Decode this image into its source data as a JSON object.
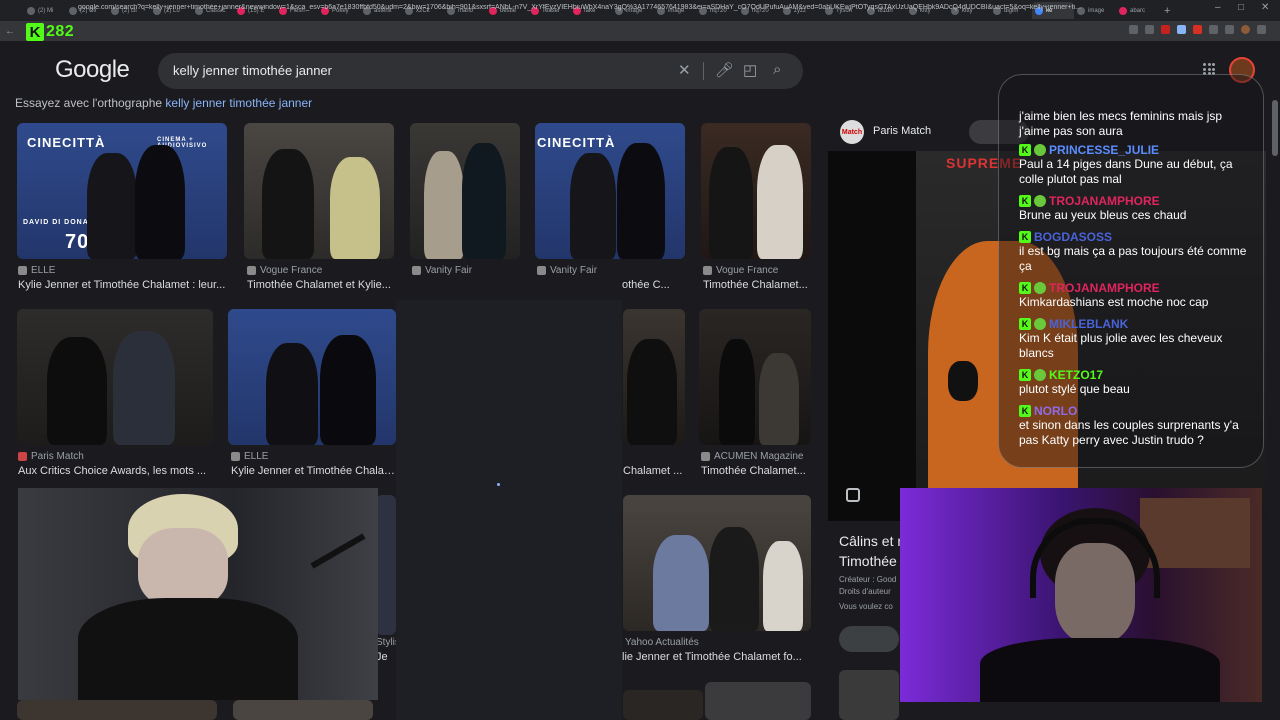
{
  "tabs": [
    {
      "label": "(2) Mi"
    },
    {
      "label": "(2) Cli"
    },
    {
      "label": "(2) cli"
    },
    {
      "label": "(2) Lo"
    },
    {
      "label": "Classic"
    },
    {
      "label": "(15) E"
    },
    {
      "label": "Flesh"
    },
    {
      "label": "Pokey"
    },
    {
      "label": "asterix"
    },
    {
      "label": "x2Ck"
    },
    {
      "label": "mario"
    },
    {
      "label": "bestle"
    },
    {
      "label": "Teaser"
    },
    {
      "label": "fake"
    },
    {
      "label": "image"
    },
    {
      "label": "image"
    },
    {
      "label": "hq720"
    },
    {
      "label": "hq720"
    },
    {
      "label": "zyzz"
    },
    {
      "label": "Tyson"
    },
    {
      "label": "i81dh"
    },
    {
      "label": "kitty"
    },
    {
      "label": "kitty"
    },
    {
      "label": "digim"
    },
    {
      "label": "ke",
      "active": true
    },
    {
      "label": "image"
    },
    {
      "label": "abarc"
    }
  ],
  "address_bar": {
    "url": "google.com/search?q=kelly+jenner+timothée+janner&newwindow=1&sca_esv=b6a7e1830ffbfd50&udm=2&biw=1706&bih=901&sxsrf=ANbL-n7V_XrYfEyzVIEHbiuWbX4naY3gQ%3A1774657641983&ei=aSDHaY_cO7OdUPufuAuAM&ved=0ahUKEwjPtOTyqsGTAxUzUaQEHbk9ADcQ4dUDCBI&uact=5&oq=kelly+jenner+ti..."
  },
  "stream": {
    "viewer_count": "282"
  },
  "google": {
    "logo": "Google",
    "query": "kelly jenner timothée janner",
    "spelling_prefix": "Essayez avec l'orthographe",
    "spelling_suggestion": "kelly jenner timothée janner"
  },
  "results": [
    {
      "source": "ELLE",
      "title": "Kylie Jenner et Timothée Chalamet : leur..."
    },
    {
      "source": "Vogue France",
      "title": "Timothée Chalamet et Kylie..."
    },
    {
      "source": "Vanity Fair",
      "title": ""
    },
    {
      "source": "Vanity Fair",
      "title": "othée C..."
    },
    {
      "source": "Vogue France",
      "title": "Timothée Chalamet..."
    },
    {
      "source": "Paris Match",
      "title": "Aux Critics Choice Awards, les mots ..."
    },
    {
      "source": "ELLE",
      "title": "Kylie Jenner et Timothée Chalame"
    },
    {
      "source": "",
      "title": "Chalamet ..."
    },
    {
      "source": "ACUMEN Magazine",
      "title": "Timothée Chalamet..."
    },
    {
      "source": "Yahoo Actualités",
      "title": "lie Jenner et Timothée Chalamet fo..."
    },
    {
      "source": "Stylis",
      "title": "Je"
    }
  ],
  "image_text": {
    "cinecitta": "CINECITTÀ",
    "donatello": "DAVID DI DONATELLO",
    "seventy": "70",
    "cinema": "CINEMA + AUDIOVISIVO",
    "supreme": "SUPREME"
  },
  "panel": {
    "source": "Paris Match",
    "logo": "Match",
    "title_line1": "Câlins et m",
    "title_line2": "Timothée",
    "creator": "Créateur : Good",
    "rights": "Droits d'auteur",
    "question": "Vous voulez co"
  },
  "chat": [
    {
      "user": "",
      "color": "#9aa0a6",
      "text": "j'aime bien les mecs feminins mais jsp j'aime pas son aura"
    },
    {
      "user": "PRINCESSE_JULIE",
      "color": "#5b8dff",
      "text": "Paul a 14 piges dans Dune au début, ça colle plutot pas mal"
    },
    {
      "user": "TROJANAMPHORE",
      "color": "#e0245e",
      "text": "Brune au yeux bleus ces chaud"
    },
    {
      "user": "BOGDASOSS",
      "color": "#4a63d8",
      "text": "il est bg mais ça a pas toujours été comme ça"
    },
    {
      "user": "TROJANAMPHORE",
      "color": "#e0245e",
      "text": "Kimkardashians est moche noc cap"
    },
    {
      "user": "MIKLEBLANK",
      "color": "#4a63d8",
      "text": "Kim K était plus jolie avec les cheveux blancs"
    },
    {
      "user": "KETZO17",
      "color": "#53fc18",
      "text": "plutot stylé que beau"
    },
    {
      "user": "NORLO",
      "color": "#8f6be8",
      "text": "et sinon dans les couples surprenants y'a pas Katty perry avec Justin trudo ?"
    }
  ],
  "colors": {
    "kick_green": "#53fc18",
    "google_link": "#8ab4f8",
    "bg": "#1b1b1f"
  }
}
